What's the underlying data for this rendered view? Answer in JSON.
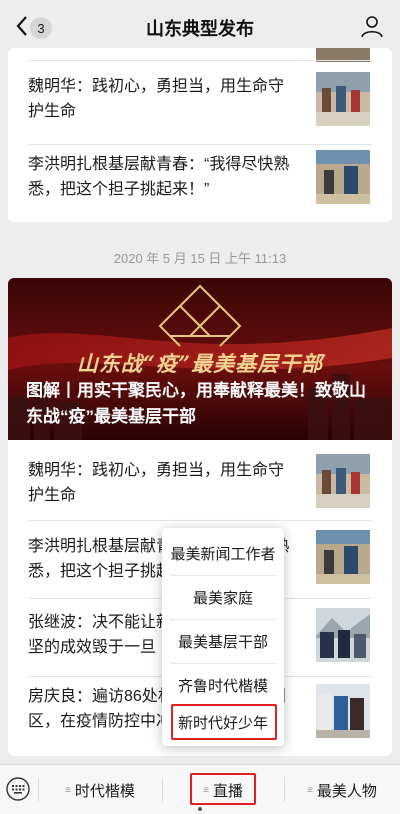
{
  "header": {
    "back_count": "3",
    "title": "山东典型发布"
  },
  "card1": {
    "items": [
      {
        "title": "魏明华：践初心，勇担当，用生命守护生命"
      },
      {
        "title": "李洪明扎根基层献青春：“我得尽快熟悉，把这个担子挑起来！”"
      }
    ]
  },
  "timestamp": "2020 年 5 月 15 日 上午 11:13",
  "card2": {
    "banner_slogan": "山东战“疫”最美基层干部",
    "banner_headline": "图解丨用实干聚民心，用奉献释最美！致敬山东战“疫”最美基层干部",
    "items": [
      {
        "title": "魏明华：践初心，勇担当，用生命守护生命"
      },
      {
        "title": "李洪明扎根基层献青春：“我得尽快熟悉，把这个担子挑起来！”"
      },
      {
        "title": "张继波：决不能让新冠疫情将脱贫攻坚的成效毁于一旦"
      },
      {
        "title": "房庆良：遍访86处村居，守好物流园区，在疫情防控中冲锋在前"
      }
    ]
  },
  "popup_menu": {
    "items": [
      "最美新闻工作者",
      "最美家庭",
      "最美基层干部",
      "齐鲁时代楷模",
      "新时代好少年"
    ]
  },
  "bottom_bar": {
    "tabs": [
      "时代楷模",
      "直播",
      "最美人物"
    ]
  },
  "colors": {
    "highlight_red": "#e02020",
    "banner_gold": "#f3d592",
    "background": "#ededed"
  }
}
